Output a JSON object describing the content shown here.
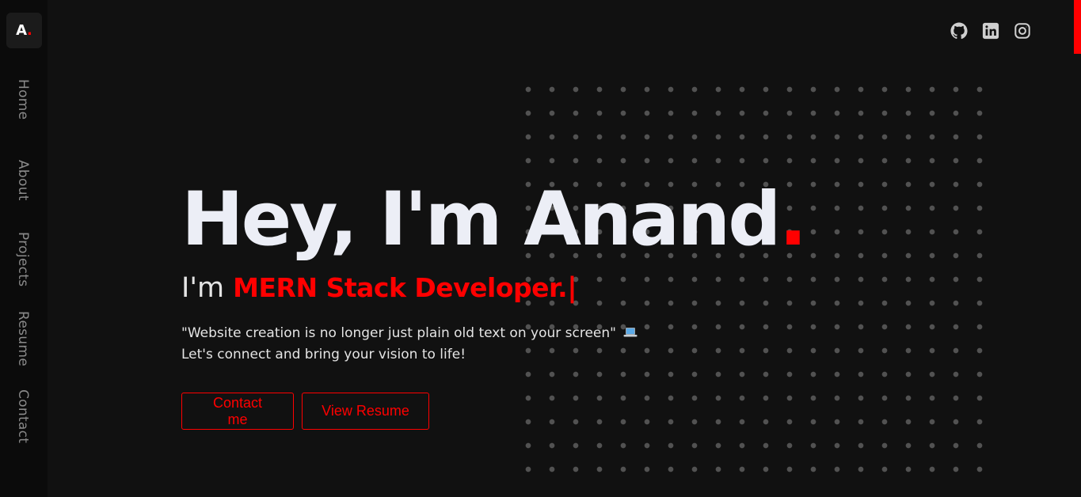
{
  "logo": {
    "letter": "A",
    "dot": "."
  },
  "nav": {
    "items": [
      {
        "label": "Home"
      },
      {
        "label": "About"
      },
      {
        "label": "Projects"
      },
      {
        "label": "Resume"
      },
      {
        "label": "Contact"
      }
    ]
  },
  "socials": [
    {
      "icon": "github-icon"
    },
    {
      "icon": "linkedin-icon"
    },
    {
      "icon": "instagram-icon"
    }
  ],
  "hero": {
    "title": "Hey, I'm Anand",
    "title_dot": ".",
    "subtitle_prefix": "I'm ",
    "subtitle_role": "MERN Stack Developer.",
    "subtitle_cursor": "|",
    "quote_line1": "\"Website creation is no longer just plain old text on your screen\"",
    "quote_emoji": "laptop-icon",
    "quote_line2": "Let's connect and bring your vision to life!"
  },
  "buttons": {
    "contact_label": "Contact me",
    "resume_label": "View Resume"
  },
  "colors": {
    "background": "#111111",
    "sidebar": "#0b0b0b",
    "accent": "#ff0000",
    "title_text": "#eceef6",
    "body_text": "#e4e4e4",
    "nav_text": "#8a8a8a"
  }
}
